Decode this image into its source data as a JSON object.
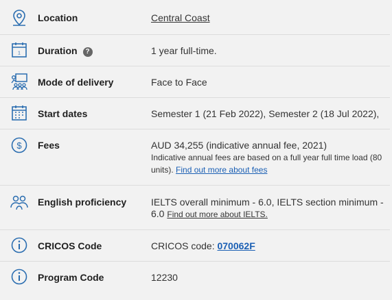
{
  "rows": {
    "location": {
      "label": "Location",
      "value": "Central Coast",
      "icon": "map-pin-icon"
    },
    "duration": {
      "label": "Duration",
      "help_glyph": "?",
      "value": "1 year full-time.",
      "icon": "calendar-icon"
    },
    "mode": {
      "label": "Mode of delivery",
      "value": "Face to Face",
      "icon": "classroom-icon"
    },
    "start": {
      "label": "Start dates",
      "value": "Semester 1 (21 Feb 2022), Semester 2 (18 Jul 2022),",
      "icon": "calendar-grid-icon"
    },
    "fees": {
      "label": "Fees",
      "value": "AUD 34,255 (indicative annual fee, 2021)",
      "note": "Indicative annual fees are based on a full year full time load (80 units).",
      "link": "Find out more about fees",
      "icon": "dollar-icon"
    },
    "english": {
      "label": "English proficiency",
      "value": "IELTS overall minimum - 6.0, IELTS section minimum - 6.0",
      "link": "Find out more about IELTS.",
      "icon": "people-icon"
    },
    "cricos": {
      "label": "CRICOS Code",
      "prefix": "CRICOS code:",
      "code": "070062F",
      "icon": "info-icon"
    },
    "program": {
      "label": "Program Code",
      "value": "12230",
      "icon": "info-icon"
    }
  },
  "colors": {
    "accent": "#1a5fb4",
    "icon": "#2a6db0",
    "divider": "#dcdcdc",
    "background": "#f2f2f2"
  }
}
